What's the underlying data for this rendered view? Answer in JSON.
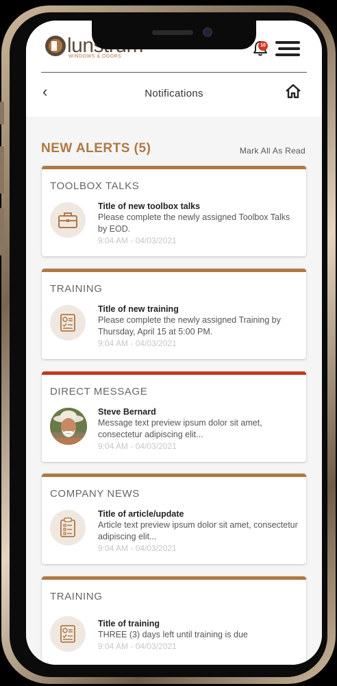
{
  "header": {
    "logo_text": "lunstrum",
    "logo_subtext": "WINDOWS & DOORS",
    "notification_count": "10",
    "page_title": "Notifications",
    "back_glyph": "‹"
  },
  "alerts": {
    "title": "NEW ALERTS (5)",
    "mark_all_label": "Mark All As Read"
  },
  "cards": [
    {
      "category": "TOOLBOX TALKS",
      "icon": "briefcase-icon",
      "heading": "Title of new toolbox talks",
      "body": "Please complete the newly assigned Toolbox Talks by EOD.",
      "time": "9:04 AM - 04/03/2021"
    },
    {
      "category": "TRAINING",
      "icon": "training-checklist-icon",
      "heading": "Title of new training",
      "body": "Please complete the newly assigned Training by Thursday, April 15 at 5:00 PM.",
      "time": "9:04 AM - 04/03/2021"
    },
    {
      "category": "DIRECT MESSAGE",
      "icon": "avatar",
      "heading": "Steve Bernard",
      "body": "Message text preview ipsum dolor sit amet, consectetur adipiscing elit...",
      "time": "9:04 AM - 04/03/2021"
    },
    {
      "category": "COMPANY NEWS",
      "icon": "clipboard-icon",
      "heading": "Title of article/update",
      "body": "Article text preview ipsum dolor sit amet, consectetur adipiscing elit...",
      "time": "9:04 AM - 04/03/2021"
    },
    {
      "category": "TRAINING",
      "icon": "training-checklist-icon",
      "heading": "Title of training",
      "body": "THREE (3) days left until training is due",
      "time": "9:04 AM - 04/03/2021"
    }
  ],
  "colors": {
    "accent": "#b07843",
    "alert_red": "#c0391c",
    "badge_red": "#d23a1e"
  }
}
